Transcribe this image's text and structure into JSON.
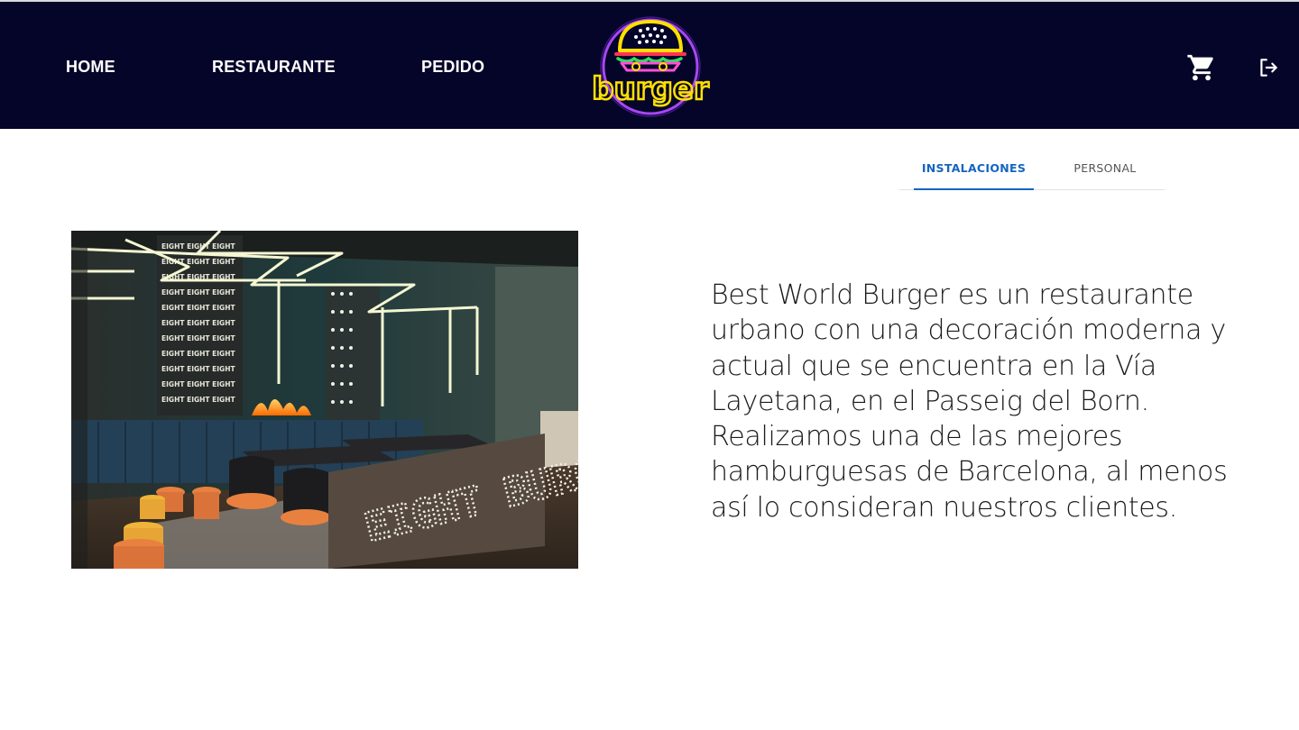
{
  "nav": {
    "home": "HOME",
    "restaurante": "RESTAURANTE",
    "pedido": "PEDIDO"
  },
  "logo": {
    "text": "burger"
  },
  "icons": {
    "cart": "shopping-cart-icon",
    "logout": "logout-icon"
  },
  "tabs": [
    {
      "label": "INSTALACIONES",
      "active": true
    },
    {
      "label": "PERSONAL",
      "active": false
    }
  ],
  "photo": {
    "sign_text": "EIGHT BURGER",
    "wall_text": "EIGHT"
  },
  "description": "Best World Burger es un restaurante urbano con una decoración moderna y actual que se encuentra en la Vía Layetana, en el Passeig del Born. Realizamos una de las mejores hamburguesas de Barcelona, al menos así lo consideran nuestros clientes.",
  "colors": {
    "header_bg": "#05052a",
    "accent": "#1565c0",
    "logo_yellow": "#ffe000",
    "logo_purple": "#b14bff"
  }
}
